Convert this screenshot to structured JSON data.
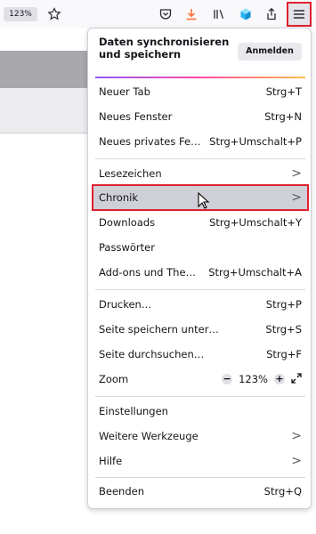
{
  "toolbar": {
    "zoom_badge": "123%",
    "icons": [
      "star-icon",
      "pocket-icon",
      "download-icon",
      "library-icon",
      "extension-icon",
      "share-icon",
      "hamburger-menu-icon"
    ]
  },
  "menu": {
    "sync_text": "Daten synchronisieren und speichern",
    "sign_in": "Anmelden",
    "group1": [
      {
        "label": "Neuer Tab",
        "shortcut": "Strg+T"
      },
      {
        "label": "Neues Fenster",
        "shortcut": "Strg+N"
      },
      {
        "label": "Neues privates Fe…",
        "shortcut": "Strg+Umschalt+P"
      }
    ],
    "group2": [
      {
        "label": "Lesezeichen",
        "shortcut": ">"
      },
      {
        "label": "Chronik",
        "shortcut": ">"
      },
      {
        "label": "Downloads",
        "shortcut": "Strg+Umschalt+Y"
      },
      {
        "label": "Passwörter",
        "shortcut": ""
      },
      {
        "label": "Add-ons und The…",
        "shortcut": "Strg+Umschalt+A"
      }
    ],
    "group3": [
      {
        "label": "Drucken…",
        "shortcut": "Strg+P"
      },
      {
        "label": "Seite speichern unter…",
        "shortcut": "Strg+S"
      },
      {
        "label": "Seite durchsuchen…",
        "shortcut": "Strg+F"
      }
    ],
    "zoom": {
      "label": "Zoom",
      "minus": "−",
      "value": "123%",
      "plus": "+"
    },
    "group4": [
      {
        "label": "Einstellungen",
        "shortcut": ""
      },
      {
        "label": "Weitere Werkzeuge",
        "shortcut": ">"
      },
      {
        "label": "Hilfe",
        "shortcut": ">"
      }
    ],
    "quit": {
      "label": "Beenden",
      "shortcut": "Strg+Q"
    }
  },
  "colors": {
    "highlight_border": "#e0202e",
    "download_orange": "#ff7139"
  }
}
